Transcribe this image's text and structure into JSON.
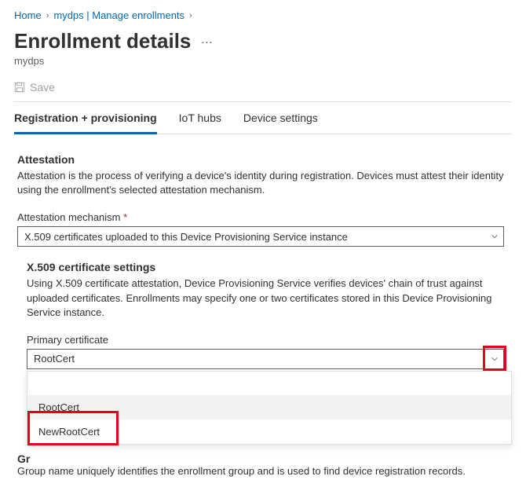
{
  "breadcrumb": {
    "home": "Home",
    "mid": "mydps | Manage enrollments"
  },
  "header": {
    "title": "Enrollment details",
    "subtitle": "mydps",
    "dots": "…"
  },
  "cmd": {
    "save": "Save"
  },
  "tabs": {
    "reg": "Registration + provisioning",
    "hubs": "IoT hubs",
    "device": "Device settings"
  },
  "attestation": {
    "title": "Attestation",
    "desc": "Attestation is the process of verifying a device's identity during registration. Devices must attest their identity using the enrollment's selected attestation mechanism.",
    "mechanism_label": "Attestation mechanism",
    "mechanism_value": "X.509 certificates uploaded to this Device Provisioning Service instance"
  },
  "x509": {
    "title": "X.509 certificate settings",
    "desc": "Using X.509 certificate attestation, Device Provisioning Service verifies devices' chain of trust against uploaded certificates. Enrollments may specify one or two certificates stored in this Device Provisioning Service instance.",
    "primary_label": "Primary certificate",
    "primary_value": "RootCert",
    "options": {
      "root": "RootCert",
      "newroot": "NewRootCert"
    }
  },
  "footer": {
    "title_frag": "Gr",
    "desc": "Group name uniquely identifies the enrollment group and is used to find device registration records."
  }
}
